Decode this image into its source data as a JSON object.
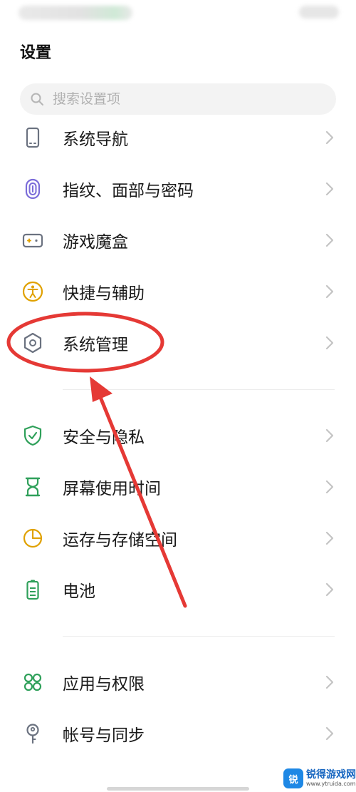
{
  "page": {
    "title": "设置"
  },
  "search": {
    "placeholder": "搜索设置项"
  },
  "items": [
    {
      "label": "系统导航",
      "icon": "phone-icon"
    },
    {
      "label": "指纹、面部与密码",
      "icon": "fingerprint-icon"
    },
    {
      "label": "游戏魔盒",
      "icon": "gamepad-icon"
    },
    {
      "label": "快捷与辅助",
      "icon": "accessibility-icon"
    },
    {
      "label": "系统管理",
      "icon": "hexagon-gear-icon"
    },
    {
      "label": "安全与隐私",
      "icon": "shield-check-icon"
    },
    {
      "label": "屏幕使用时间",
      "icon": "hourglass-icon"
    },
    {
      "label": "运存与存储空间",
      "icon": "pie-chart-icon"
    },
    {
      "label": "电池",
      "icon": "battery-icon"
    },
    {
      "label": "应用与权限",
      "icon": "grid-icon"
    },
    {
      "label": "帐号与同步",
      "icon": "key-icon"
    }
  ],
  "annotation": {
    "highlight_color": "#e53935",
    "highlighted_item": "系统管理"
  },
  "watermark": {
    "logo_text": "锐",
    "name": "锐得游戏网",
    "url": "www.ytruida.com"
  },
  "colors": {
    "gray_icon": "#6b7280",
    "purple_icon": "#7b6cd9",
    "amber_icon": "#e0a100",
    "green_icon": "#2fa05a",
    "chevron": "#c4c4c4"
  }
}
